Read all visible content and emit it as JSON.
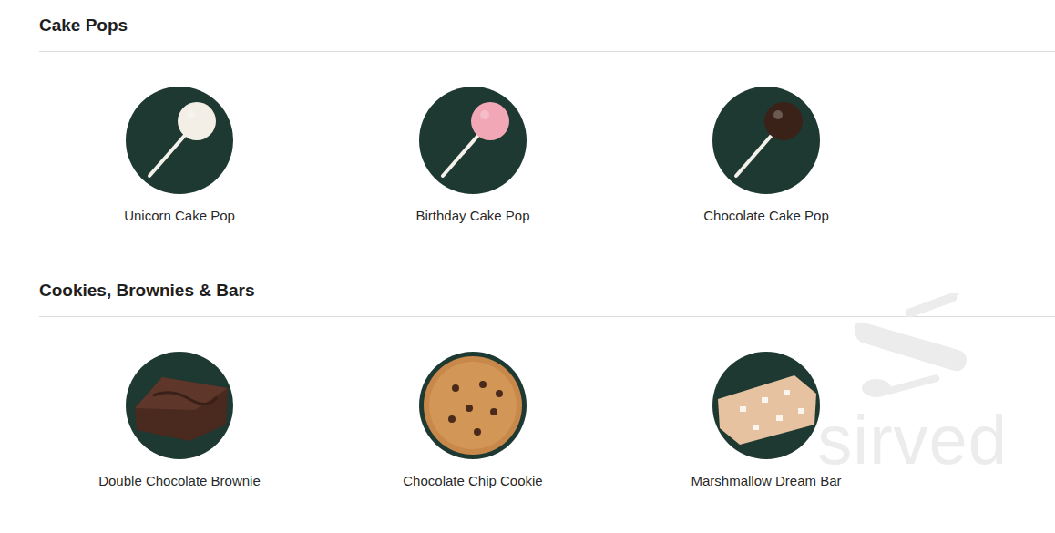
{
  "sections": [
    {
      "title": "Cake Pops",
      "items": [
        {
          "name": "Unicorn Cake Pop",
          "kind": "pop",
          "color": "#f3eee6"
        },
        {
          "name": "Birthday Cake Pop",
          "kind": "pop",
          "color": "#f2a7b6"
        },
        {
          "name": "Chocolate Cake Pop",
          "kind": "pop",
          "color": "#3b2219"
        }
      ]
    },
    {
      "title": "Cookies, Brownies & Bars",
      "items": [
        {
          "name": "Double Chocolate Brownie",
          "kind": "brownie"
        },
        {
          "name": "Chocolate Chip Cookie",
          "kind": "cookie"
        },
        {
          "name": "Marshmallow Dream Bar",
          "kind": "bar"
        }
      ]
    }
  ],
  "watermark": {
    "text": "sirved"
  }
}
